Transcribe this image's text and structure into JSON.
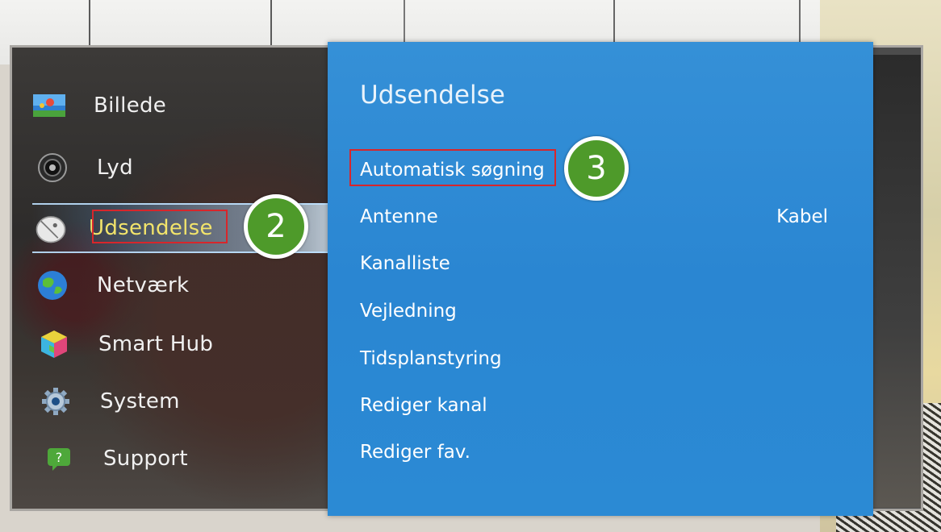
{
  "menu": {
    "items": [
      {
        "label": "Billede",
        "icon": "picture-icon"
      },
      {
        "label": "Lyd",
        "icon": "speaker-icon"
      },
      {
        "label": "Udsendelse",
        "icon": "satellite-dish-icon",
        "active": true
      },
      {
        "label": "Netværk",
        "icon": "globe-icon"
      },
      {
        "label": "Smart Hub",
        "icon": "smart-hub-cube-icon"
      },
      {
        "label": "System",
        "icon": "gear-icon"
      },
      {
        "label": "Support",
        "icon": "help-icon"
      }
    ]
  },
  "panel": {
    "title": "Udsendelse",
    "rows": [
      {
        "label": "Automatisk søgning",
        "value": ""
      },
      {
        "label": "Antenne",
        "value": "Kabel"
      },
      {
        "label": "Kanalliste",
        "value": ""
      },
      {
        "label": "Vejledning",
        "value": ""
      },
      {
        "label": "Tidsplanstyring",
        "value": ""
      },
      {
        "label": "Rediger kanal",
        "value": ""
      },
      {
        "label": "Rediger fav.",
        "value": ""
      }
    ]
  },
  "annotations": {
    "step2": "2",
    "step3": "3"
  },
  "colors": {
    "panel_blue": "#2a86d2",
    "active_text": "#f2e46b",
    "badge_green": "#4e9a2a",
    "highlight_red": "#d8262b"
  }
}
